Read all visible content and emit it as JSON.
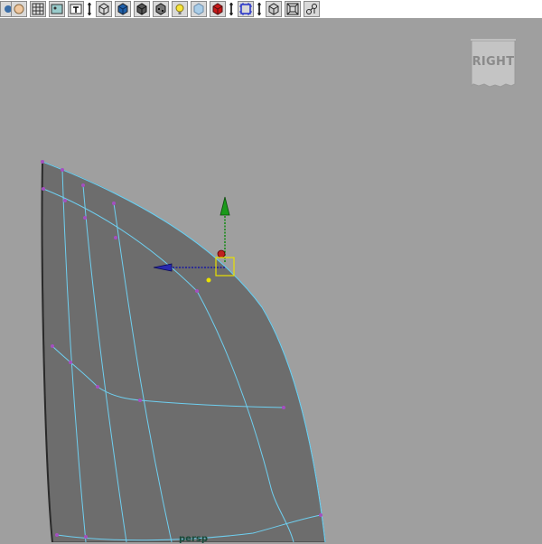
{
  "toolbar": {
    "icons": [
      "select-object-icon",
      "lasso-icon",
      "grid-snap-icon",
      "image-plane-icon",
      "text-icon",
      "wireframe-cube-icon",
      "smooth-shade-cube-icon",
      "shaded-cube-icon",
      "textured-cube-icon",
      "light-bulb-icon",
      "xray-cube-icon",
      "isolate-cube-icon",
      "frame-selected-icon",
      "resolution-gate-icon",
      "film-gate-icon",
      "joint-xray-icon"
    ]
  },
  "viewport": {
    "viewcube_label": "RIGHT",
    "camera_label": "persp"
  },
  "colors": {
    "background": "#9f9f9f",
    "mesh_fill": "#6d6d6d",
    "wire": "#6ecff0",
    "vertex": "#a44fc0",
    "manip_x": "#1a1aa0",
    "manip_y": "#108a10",
    "manip_center": "#e8e000"
  }
}
